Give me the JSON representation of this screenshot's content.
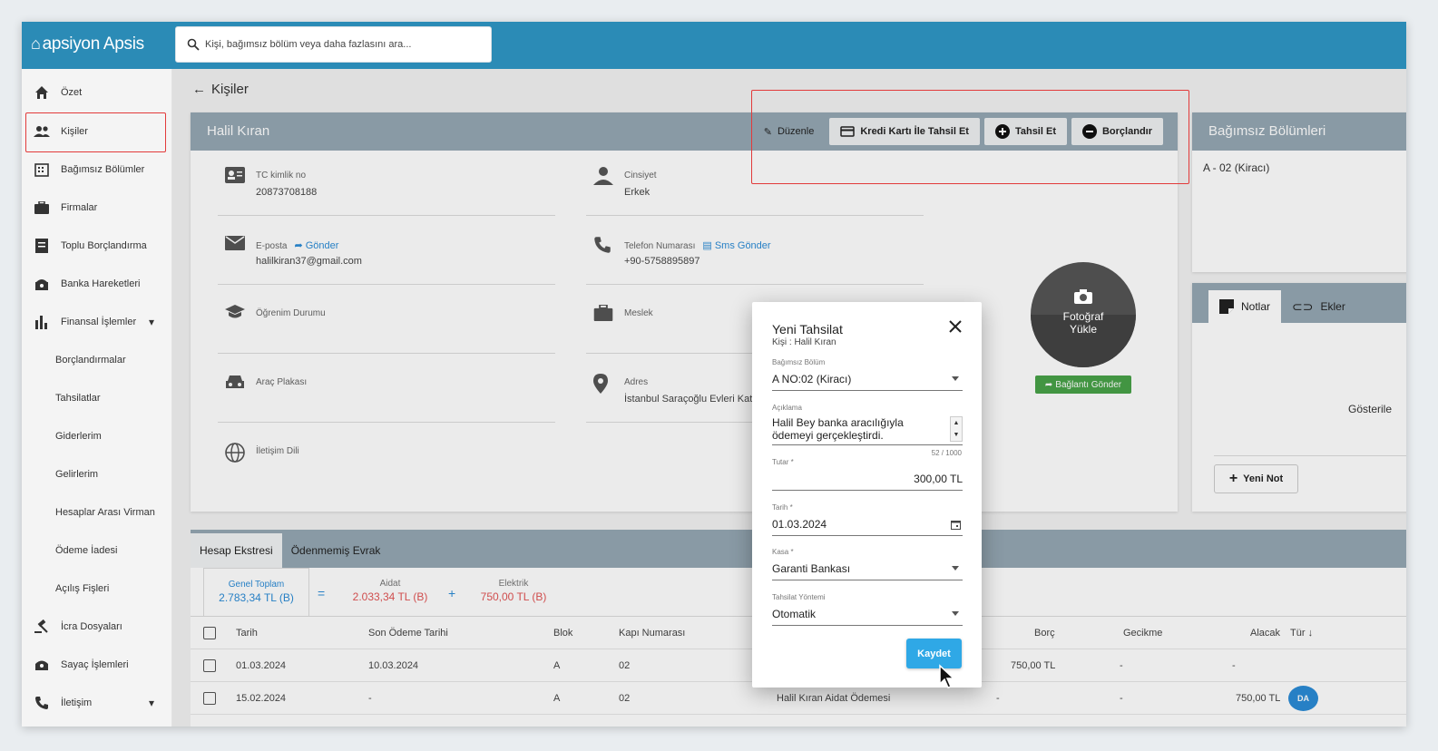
{
  "app": {
    "logo_text": "apsiyon Apsis",
    "search_placeholder": "Kişi, bağımsız bölüm veya daha fazlasını ara..."
  },
  "sidebar": {
    "items": [
      {
        "label": "Özet",
        "icon": "home-icon"
      },
      {
        "label": "Kişiler",
        "icon": "people-icon"
      },
      {
        "label": "Bağımsız Bölümler",
        "icon": "building-icon"
      },
      {
        "label": "Firmalar",
        "icon": "briefcase-icon"
      },
      {
        "label": "Toplu Borçlandırma",
        "icon": "receipt-icon"
      },
      {
        "label": "Banka Hareketleri",
        "icon": "bank-icon"
      },
      {
        "label": "Finansal İşlemler",
        "icon": "bar-chart-icon"
      },
      {
        "label": "Borçlandırmalar"
      },
      {
        "label": "Tahsilatlar"
      },
      {
        "label": "Giderlerim"
      },
      {
        "label": "Gelirlerim"
      },
      {
        "label": "Hesaplar Arası Virman"
      },
      {
        "label": "Ödeme İadesi"
      },
      {
        "label": "Açılış Fişleri"
      },
      {
        "label": "İcra Dosyaları",
        "icon": "gavel-icon"
      },
      {
        "label": "Sayaç İşlemleri",
        "icon": "meter-icon"
      },
      {
        "label": "İletişim",
        "icon": "phone-icon"
      }
    ]
  },
  "page": {
    "back_label": "Kişiler",
    "person_name": "Halil Kıran",
    "actions": {
      "edit": "Düzenle",
      "card_collect": "Kredi Kartı İle Tahsil Et",
      "collect": "Tahsil Et",
      "debit": "Borçlandır"
    },
    "fields": {
      "tc_label": "TC kimlik no",
      "tc_value": "20873708188",
      "gender_label": "Cinsiyet",
      "gender_value": "Erkek",
      "email_label": "E-posta",
      "email_link": "Gönder",
      "email_value": "halilkiran37@gmail.com",
      "phone_label": "Telefon Numarası",
      "phone_link": "Sms Gönder",
      "phone_value": "+90-5758895897",
      "education_label": "Öğrenim Durumu",
      "job_label": "Meslek",
      "plate_label": "Araç Plakası",
      "address_label": "Adres",
      "address_value": "İstanbul Saraçoğlu Evleri Kat 1 D",
      "language_label": "İletişim Dili"
    },
    "photo_label": "Fotoğraf Yükle",
    "send_link_label": "Bağlantı Gönder",
    "units_title": "Bağımsız Bölümleri",
    "unit_value": "A - 02 (Kiracı)",
    "notes_tab": "Notlar",
    "attachments_tab": "Ekler",
    "notes_empty_partial": "Gösterile",
    "new_note": "Yeni Not"
  },
  "statement": {
    "tabs": [
      "Hesap Ekstresi",
      "Ödenmemiş Evrak"
    ],
    "total_label": "Genel Toplam",
    "total_value": "2.783,34 TL (B)",
    "dues_label": "Aidat",
    "dues_value": "2.033,34 TL (B)",
    "electric_label": "Elektrik",
    "electric_value": "750,00 TL (B)",
    "columns": [
      "Tarih",
      "Son Ödeme Tarihi",
      "Blok",
      "Kapı Numarası",
      "Borç",
      "Gecikme",
      "Alacak",
      "Tür"
    ],
    "rows": [
      {
        "date": "01.03.2024",
        "due": "10.03.2024",
        "block": "A",
        "door": "02",
        "desc": "",
        "debt": "750,00 TL",
        "delay": "-",
        "credit": "-",
        "type": ""
      },
      {
        "date": "15.02.2024",
        "due": "-",
        "block": "A",
        "door": "02",
        "desc": "Halil Kıran Aidat Ödemesi",
        "debt": "-",
        "delay": "-",
        "credit": "750,00 TL",
        "type": "DA"
      }
    ]
  },
  "modal": {
    "title": "Yeni Tahsilat",
    "subtitle": "Kişi : Halil Kıran",
    "unit_label": "Bağımsız Bölüm",
    "unit_value": "A NO:02 (Kiracı)",
    "desc_label": "Açıklama",
    "desc_line1": "Halil Bey banka aracılığıyla",
    "desc_line2": "ödemeyi gerçekleştirdi.",
    "counter": "52 / 1000",
    "amount_label": "Tutar *",
    "amount_value": "300,00 TL",
    "date_label": "Tarih *",
    "date_value": "01.03.2024",
    "cash_label": "Kasa *",
    "cash_value": "Garanti Bankası",
    "method_label": "Tahsilat Yöntemi",
    "method_value": "Otomatik",
    "save": "Kaydet"
  },
  "colors": {
    "topbar": "#2b8bb6",
    "header_gray": "#95a8b4",
    "accent": "#2b8bd6",
    "highlight": "#e23a3a",
    "save": "#2fa8e6"
  }
}
